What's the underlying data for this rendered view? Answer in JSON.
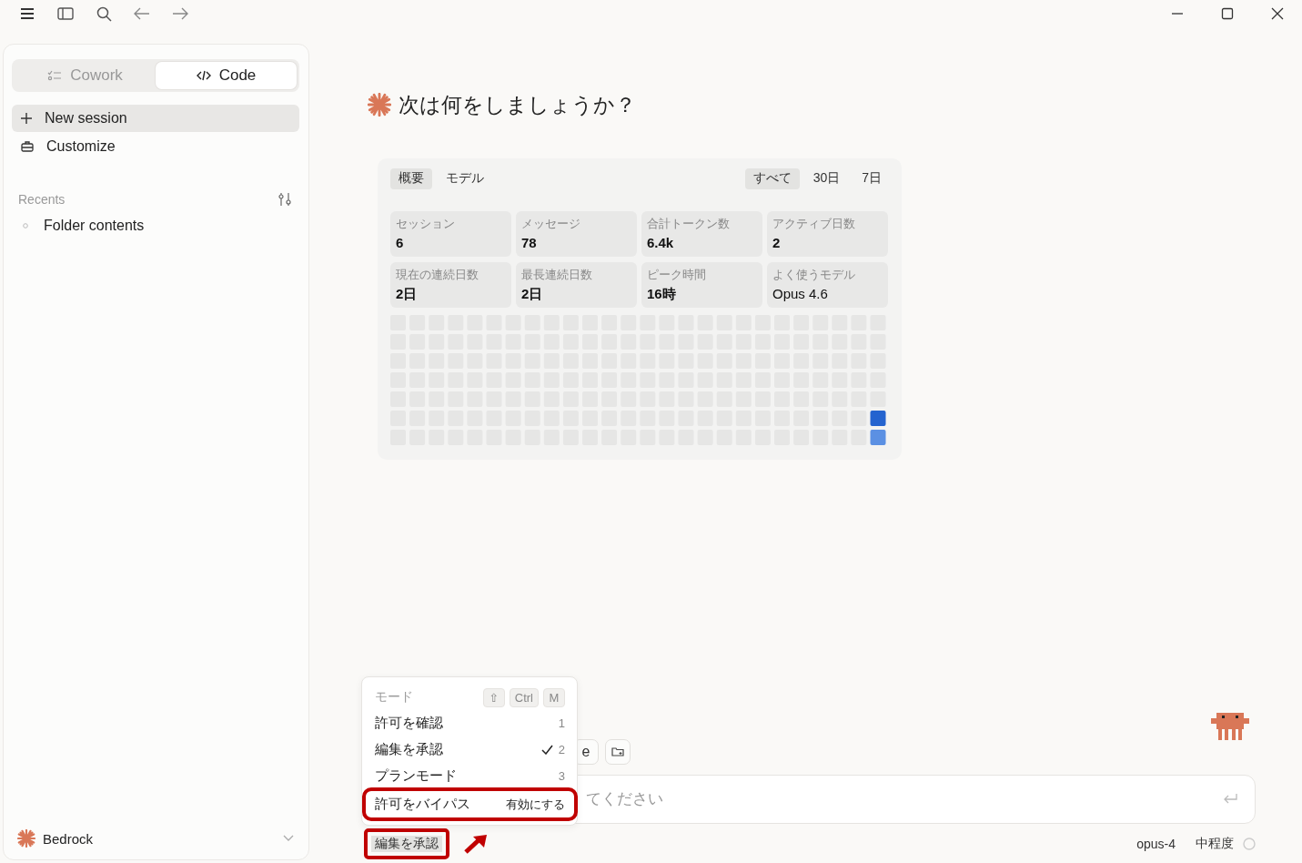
{
  "sidebar": {
    "mode_tabs": [
      {
        "label": "Cowork",
        "selected": false
      },
      {
        "label": "Code",
        "selected": true
      }
    ],
    "nav": [
      {
        "label": "New session",
        "kind": "new",
        "selected": true
      },
      {
        "label": "Customize",
        "kind": "customize",
        "selected": false
      }
    ],
    "recents": {
      "title": "Recents",
      "items": [
        {
          "label": "Folder contents"
        }
      ]
    },
    "account": {
      "label": "Bedrock"
    }
  },
  "heading": "次は何をしましょうか？",
  "stats": {
    "tabs": [
      {
        "label": "概要",
        "selected": true
      },
      {
        "label": "モデル",
        "selected": false
      }
    ],
    "ranges": [
      {
        "label": "すべて",
        "selected": true
      },
      {
        "label": "30日",
        "selected": false
      },
      {
        "label": "7日",
        "selected": false
      }
    ],
    "cards": [
      {
        "label": "セッション",
        "value": "6",
        "kind": "number"
      },
      {
        "label": "メッセージ",
        "value": "78",
        "kind": "number"
      },
      {
        "label": "合計トークン数",
        "value": "6.4k",
        "kind": "number"
      },
      {
        "label": "アクティブ日数",
        "value": "2",
        "kind": "number"
      },
      {
        "label": "現在の連続日数",
        "value": "2日",
        "kind": "number"
      },
      {
        "label": "最長連続日数",
        "value": "2日",
        "kind": "number"
      },
      {
        "label": "ピーク時間",
        "value": "16時",
        "kind": "number"
      },
      {
        "label": "よく使うモデル",
        "value": "Opus 4.6",
        "kind": "text"
      }
    ]
  },
  "composer": {
    "chips": [
      {
        "label": "e"
      }
    ],
    "placeholder": "てください"
  },
  "mode_menu": {
    "title": "モード",
    "keys": [
      "⇧",
      "Ctrl",
      "M"
    ],
    "items": [
      {
        "label": "許可を確認",
        "shortcut": "1",
        "selected": false,
        "highlighted": false
      },
      {
        "label": "編集を承認",
        "shortcut": "2",
        "selected": true,
        "highlighted": false
      },
      {
        "label": "プランモード",
        "shortcut": "3",
        "selected": false,
        "highlighted": false
      },
      {
        "label": "許可をバイパス",
        "shortcut": "有効にする",
        "selected": false,
        "highlighted": true
      }
    ]
  },
  "footer": {
    "mode_button": {
      "label": "編集を承認",
      "highlighted": true
    },
    "model": "opus-4",
    "effort": "中程度"
  }
}
